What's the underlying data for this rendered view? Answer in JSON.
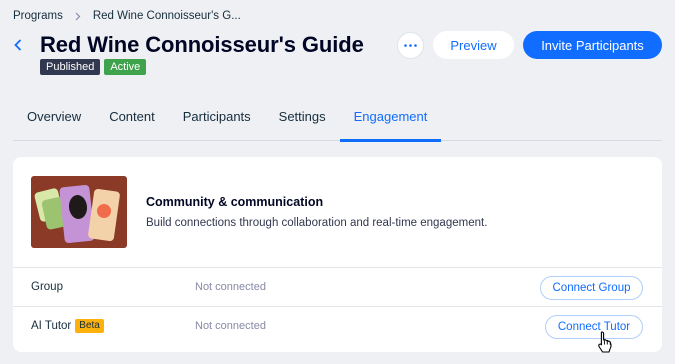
{
  "breadcrumb": {
    "root": "Programs",
    "current": "Red Wine Connoisseur's G..."
  },
  "header": {
    "title": "Red Wine Connoisseur's Guide",
    "badges": [
      "Published",
      "Active"
    ],
    "preview_label": "Preview",
    "invite_label": "Invite Participants",
    "more_label": "···"
  },
  "tabs": [
    {
      "label": "Overview"
    },
    {
      "label": "Content"
    },
    {
      "label": "Participants"
    },
    {
      "label": "Settings"
    },
    {
      "label": "Engagement",
      "active": true
    }
  ],
  "engagement": {
    "title": "Community & communication",
    "description": "Build connections through collaboration and real-time engagement.",
    "rows": [
      {
        "label": "Group",
        "badge": "",
        "status": "Not connected",
        "button": "Connect Group"
      },
      {
        "label": "AI Tutor",
        "badge": "Beta",
        "status": "Not connected",
        "button": "Connect Tutor"
      }
    ]
  },
  "colors": {
    "accent": "#116dff",
    "published": "#32384f",
    "active": "#3fa34d",
    "beta": "#fdb10c",
    "hero_bg": "#8a3a26"
  }
}
